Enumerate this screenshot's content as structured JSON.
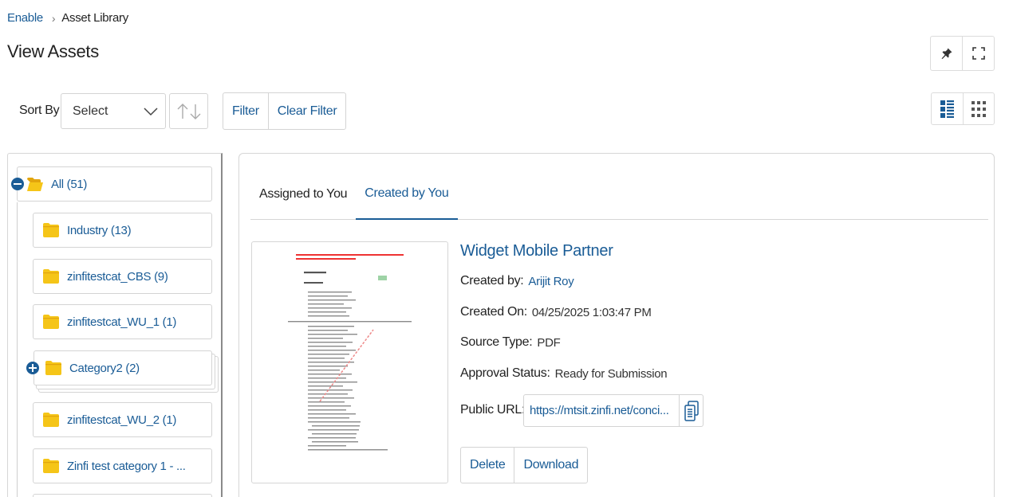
{
  "breadcrumb": {
    "root": "Enable",
    "current": "Asset Library"
  },
  "page": {
    "title": "View Assets"
  },
  "toolbar": {
    "sort_label": "Sort By",
    "sort_selected": "Select",
    "filter_label": "Filter",
    "clear_filter_label": "Clear Filter"
  },
  "tree": {
    "root": "All (51)",
    "items": [
      "Industry (13)",
      "zinfitestcat_CBS (9)",
      "zinfitestcat_WU_1 (1)",
      "Category2 (2)",
      "zinfitestcat_WU_2 (1)",
      "Zinfi test category 1 - ..."
    ]
  },
  "tabs": [
    {
      "label": "Assigned to You",
      "active": false
    },
    {
      "label": "Created by You",
      "active": true
    }
  ],
  "asset": {
    "title": "Widget Mobile Partner",
    "created_by_label": "Created by:",
    "created_by": "Arijit Roy",
    "created_on_label": "Created On:",
    "created_on": "04/25/2025 1:03:47 PM",
    "source_type_label": "Source Type:",
    "source_type": "PDF",
    "approval_status_label": "Approval Status:",
    "approval_status": "Ready for Submission",
    "public_url_label": "Public URL:",
    "public_url": "https://mtsit.zinfi.net/conci...",
    "delete_label": "Delete",
    "download_label": "Download"
  },
  "colors": {
    "accent": "#1a5c96",
    "folder": "#f5c518",
    "border": "#d4d4d4"
  },
  "icons": {
    "pin": "pin-icon",
    "fullscreen": "fullscreen-icon",
    "list_view": "list-view-icon",
    "grid_view": "grid-view-icon",
    "folder": "folder-icon",
    "copy": "copy-icon"
  }
}
